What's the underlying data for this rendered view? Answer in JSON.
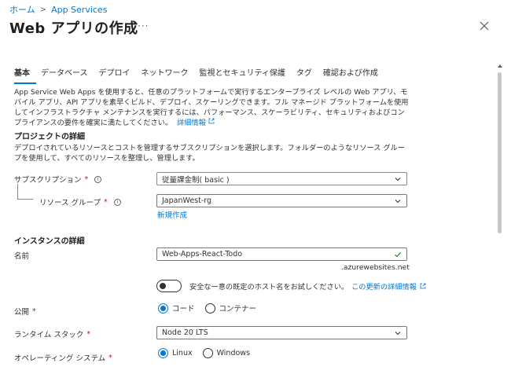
{
  "breadcrumb": {
    "home": "ホーム",
    "sep": ">",
    "app_services": "App Services"
  },
  "page": {
    "title": "Web アプリの作成",
    "more": "···",
    "close": "×"
  },
  "tabs": [
    {
      "label": "基本",
      "active": true
    },
    {
      "label": "データベース"
    },
    {
      "label": "デプロイ"
    },
    {
      "label": "ネットワーク"
    },
    {
      "label": "監視とセキュリティ保護"
    },
    {
      "label": "タグ"
    },
    {
      "label": "確認および作成"
    }
  ],
  "intro": {
    "text": "App Service Web Apps を使用すると、任意のプラットフォームで実行するエンタープライズ レベルの Web アプリ、モバイル アプリ、API アプリを素早くビルド、デプロイ、スケーリングできます。フル マネージド プラットフォームを使用してインフラストラクチャ メンテナンスを実行するには、パフォーマンス、スケーラビリティ、セキュリティおよびコンプライアンスの要件を確実に満たしてください。",
    "link": "詳細情報"
  },
  "project": {
    "heading": "プロジェクトの詳細",
    "desc": "デプロイされているリソースとコストを管理するサブスクリプションを選択します。フォルダーのようなリソース グループを使用して、すべてのリソースを整理し、管理します。",
    "subscription_label": "サブスクリプション",
    "subscription_value": "従量課金制( basic )",
    "resource_group_label": "リソース グループ",
    "resource_group_value": "JapanWest-rg",
    "create_new": "新規作成"
  },
  "instance": {
    "heading": "インスタンスの詳細",
    "name_label": "名前",
    "name_value": "Web-Apps-React-Todo",
    "domain_suffix": ".azurewebsites.net",
    "unique_host_text": "安全な一意の既定のホスト名をお試しください。",
    "unique_host_link": "この更新の詳細情報",
    "publish_label": "公開",
    "publish_options": [
      "コード",
      "コンテナー"
    ],
    "runtime_label": "ランタイム スタック",
    "runtime_value": "Node 20 LTS",
    "os_label": "オペレーティング システム",
    "os_options": [
      "Linux",
      "Windows"
    ]
  },
  "required_mark": "*",
  "colors": {
    "accent": "#0078d4",
    "focus": "#8764b8",
    "valid": "#107c10",
    "required": "#a4262c"
  }
}
